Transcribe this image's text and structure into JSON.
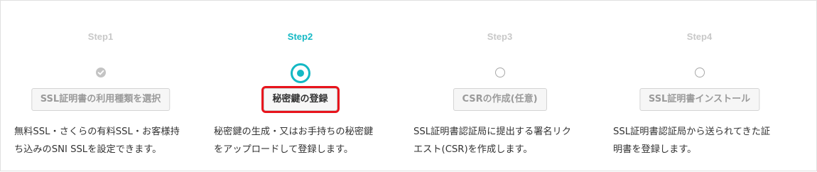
{
  "steps": [
    {
      "title": "Step1",
      "state": "completed",
      "button_label": "SSL証明書の利用種類を選択",
      "description": "無料SSL・さくらの有料SSL・お客様持\nち込みのSNI SSLを設定できます。"
    },
    {
      "title": "Step2",
      "state": "active",
      "button_label": "秘密鍵の登録",
      "description": "秘密鍵の生成・又はお手持ちの秘密鍵\nをアップロードして登録します。"
    },
    {
      "title": "Step3",
      "state": "pending",
      "button_label": "CSRの作成(任意)",
      "description": "SSL証明書認証局に提出する署名リク\nエスト(CSR)を作成します。"
    },
    {
      "title": "Step4",
      "state": "pending",
      "button_label": "SSL証明書インストール",
      "description": "SSL証明書認証局から送られてきた証\n明書を登録します。"
    }
  ],
  "colors": {
    "accent": "#14b8c4",
    "highlight_border": "#e8141c",
    "inactive": "#c8c8c8"
  },
  "icons": {
    "completed": "check-circle-icon",
    "active": "radio-selected-icon",
    "pending": "radio-empty-icon"
  }
}
